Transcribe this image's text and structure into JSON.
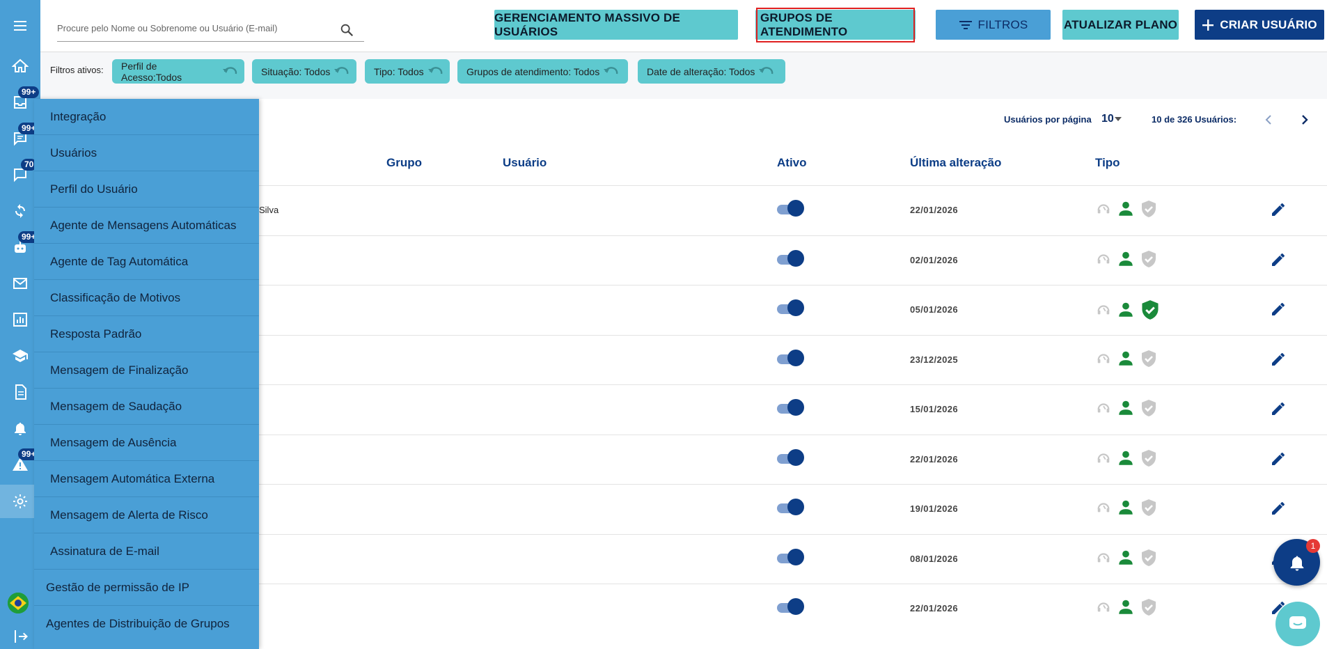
{
  "colors": {
    "rail": "#4a9fd6",
    "teal": "#5ec9cf",
    "navy": "#0d3d86",
    "active_border": "#e02020",
    "green": "#1a8a3a"
  },
  "rail": {
    "badges": [
      "99+",
      "99+",
      "70",
      "99+",
      "99+"
    ],
    "icons": [
      "menu-icon",
      "home-icon",
      "inbox-icon",
      "chat-icon",
      "message-icon",
      "sync-icon",
      "bot-icon",
      "mail-icon",
      "chart-icon",
      "school-icon",
      "document-icon",
      "bell-icon",
      "warning-icon",
      "gear-icon",
      "flag-icon",
      "logout-icon"
    ]
  },
  "search": {
    "placeholder": "Procure pelo Nome ou Sobrenome ou Usuário (E-mail)"
  },
  "toolbar": {
    "mass": "GERENCIAMENTO MASSIVO DE USUÁRIOS",
    "groups": "GRUPOS DE ATENDIMENTO",
    "filters": "FILTROS",
    "update_plan": "ATUALIZAR PLANO",
    "create_user": "CRIAR USUÁRIO"
  },
  "filters": {
    "label": "Filtros ativos:",
    "chips": [
      "Perfil de Acesso:Todos",
      "Situação: Todos",
      "Tipo: Todos",
      "Grupos de atendimento: Todos",
      "Date de alteração: Todos"
    ]
  },
  "pager": {
    "per_page_label": "Usuários por página",
    "per_page": "10",
    "count": "10 de 326 Usuários:"
  },
  "table": {
    "headers": {
      "group": "Grupo",
      "user": "Usuário",
      "active": "Ativo",
      "last_change": "Última alteração",
      "type": "Tipo"
    },
    "rows": [
      {
        "name": "Silva",
        "active": true,
        "date": "22/01/2026",
        "admin": false
      },
      {
        "name": "",
        "active": true,
        "date": "02/01/2026",
        "admin": false
      },
      {
        "name": "",
        "active": true,
        "date": "05/01/2026",
        "admin": true
      },
      {
        "name": "",
        "active": true,
        "date": "23/12/2025",
        "admin": false
      },
      {
        "name": "",
        "active": true,
        "date": "15/01/2026",
        "admin": false
      },
      {
        "name": "",
        "active": true,
        "date": "22/01/2026",
        "admin": false
      },
      {
        "name": "",
        "active": true,
        "date": "19/01/2026",
        "admin": false
      },
      {
        "name": "",
        "active": true,
        "date": "08/01/2026",
        "admin": false
      },
      {
        "name": "",
        "active": true,
        "date": "22/01/2026",
        "admin": false
      }
    ]
  },
  "menu": {
    "items": [
      "Integração",
      "Usuários",
      "Perfil do Usuário",
      "Agente de Mensagens Automáticas",
      "Agente de Tag Automática",
      "Classificação de Motivos",
      "Resposta Padrão",
      "Mensagem de Finalização",
      "Mensagem de Saudação",
      "Mensagem de Ausência",
      "Mensagem Automática Externa",
      "Mensagem de Alerta de Risco",
      "Assinatura de E-mail",
      "Gestão de permissão de IP",
      "Agentes de Distribuição de Grupos"
    ]
  },
  "notifications": {
    "count": "1"
  }
}
